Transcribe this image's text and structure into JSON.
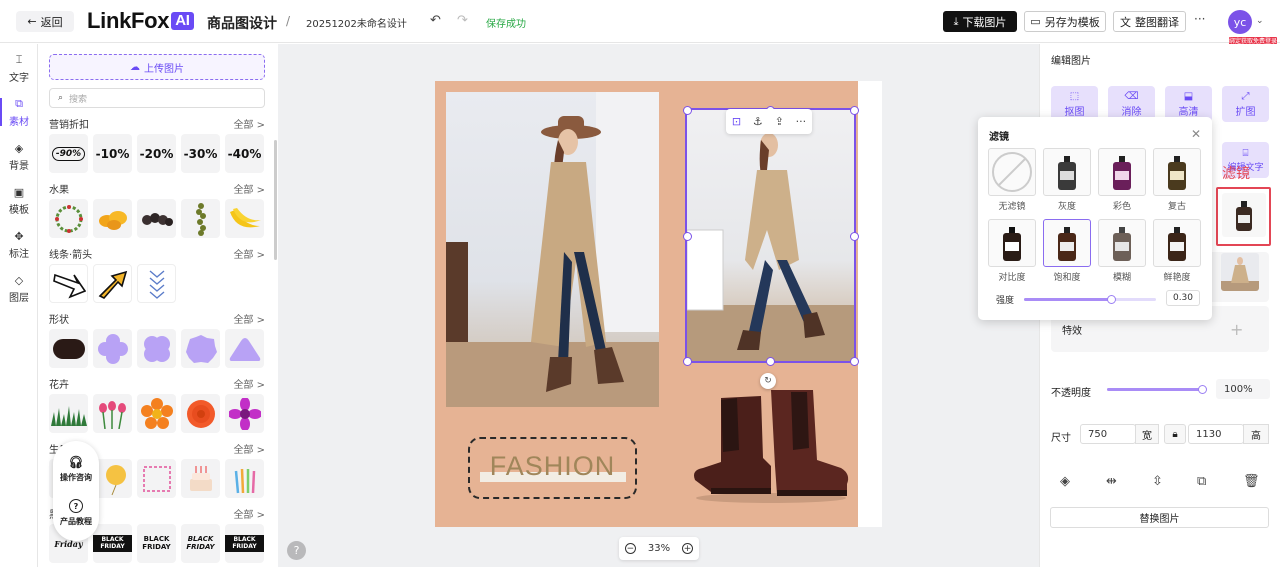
{
  "topbar": {
    "back_label": "返回",
    "logo_text": "LinkFox",
    "logo_badge": "AI",
    "app_title": "商品图设计",
    "separator": "/",
    "doc_name": "20251202未命名设计",
    "undo_icon": "undo-icon",
    "redo_icon": "redo-icon",
    "save_status": "保存成功",
    "download_label": "下载图片",
    "save_template_label": "另存为模板",
    "translate_label": "整图翻译",
    "more_label": "···",
    "avatar_initials": "yc",
    "bind_badge": "绑定获取免费登录"
  },
  "leftnav": {
    "items": [
      {
        "label": "文字",
        "icon": "text-icon"
      },
      {
        "label": "素材",
        "icon": "assets-icon"
      },
      {
        "label": "背景",
        "icon": "background-icon"
      },
      {
        "label": "模板",
        "icon": "template-icon"
      },
      {
        "label": "标注",
        "icon": "annotate-icon"
      },
      {
        "label": "图层",
        "icon": "layers-icon"
      }
    ],
    "active": "素材"
  },
  "assets": {
    "upload_label": "上传图片",
    "search_placeholder": "搜索",
    "all_label": "全部 >",
    "categories": [
      {
        "title": "营销折扣",
        "tiles": [
          "-90%",
          "-10%",
          "-20%",
          "-30%",
          "-40%"
        ]
      },
      {
        "title": "水果",
        "tiles": [
          "",
          "",
          "",
          "",
          ""
        ]
      },
      {
        "title": "线条·箭头",
        "tiles": [
          "",
          "",
          ""
        ]
      },
      {
        "title": "形状",
        "tiles": [
          "",
          "",
          "",
          "",
          ""
        ]
      },
      {
        "title": "花卉",
        "tiles": [
          "",
          "",
          "",
          "",
          ""
        ]
      },
      {
        "title": "生日",
        "tiles": [
          "",
          "",
          "",
          "",
          ""
        ]
      },
      {
        "title": "黑",
        "tiles": [
          "Friday",
          "BLACK FRIDAY",
          "BLACK FRIDAY",
          "BLACK FRIDAY",
          "BLACK FRIDAY"
        ]
      }
    ]
  },
  "help_float": {
    "consult_label": "操作咨询",
    "tutorial_label": "产品教程"
  },
  "canvas": {
    "fashion_text": "FASHION",
    "zoom_value": "33%",
    "zoom_out": "−",
    "zoom_in": "+",
    "help": "?",
    "colors": {
      "poster_bg": "#e6b394",
      "accent": "#7b52e8"
    }
  },
  "right_panel": {
    "title": "编辑图片",
    "tools": [
      "抠图",
      "消除",
      "高清",
      "扩图"
    ],
    "edit_text": "编辑文字",
    "filter_label_red": "滤镜",
    "effects_label": "特效",
    "opacity_label": "不透明度",
    "opacity_value": "100%",
    "size_label": "尺寸",
    "width_value": "750",
    "width_unit": "宽",
    "height_value": "1130",
    "height_unit": "高",
    "replace_label": "替换图片"
  },
  "filter_popup": {
    "title": "滤镜",
    "filters": [
      "无滤镜",
      "灰度",
      "彩色",
      "复古",
      "对比度",
      "饱和度",
      "模糊",
      "鲜艳度"
    ],
    "selected": "饱和度",
    "strength_label": "强度",
    "strength_value": "0.30",
    "strength_fraction": 0.3
  }
}
